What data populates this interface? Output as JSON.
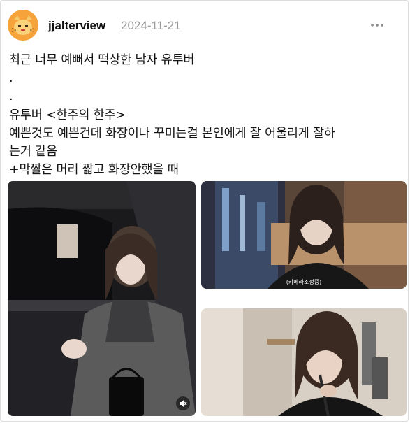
{
  "post": {
    "username": "jjalterview",
    "date": "2024-11-21",
    "more_icon": "more-horizontal-icon",
    "lines": [
      "최근 너무 예뻐서 떡상한 남자 유투버",
      ".",
      ".",
      "유투버 <한주의 한주>",
      "예쁜것도 예쁜건데 화장이나 꾸미는걸 본인에게 잘 어울리게 잘하",
      "는거 같음",
      "+막짤은 머리 짧고 화장안했을 때"
    ],
    "images": [
      {
        "name": "photo-car-selfie"
      },
      {
        "name": "photo-window-selfie",
        "caption": "(카메라조정중)"
      },
      {
        "name": "photo-makeup"
      }
    ],
    "mute_icon": "volume-mute-icon"
  },
  "colors": {
    "accent": "#f4a03a",
    "date": "#9a9a9a",
    "border": "#dcdcdc"
  }
}
